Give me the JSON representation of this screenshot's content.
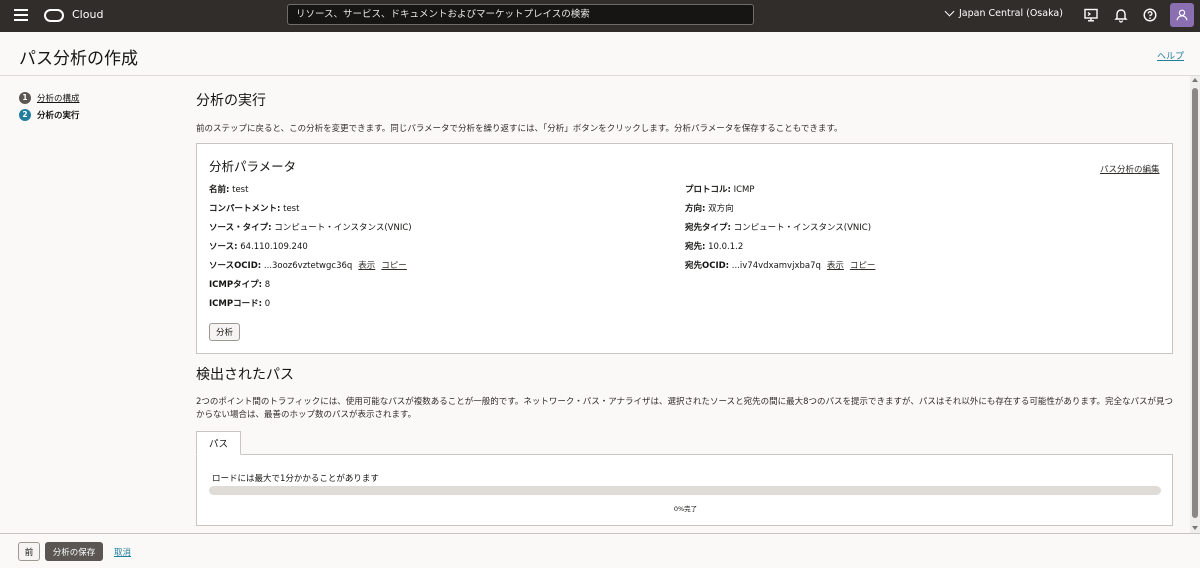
{
  "topbar": {
    "brand": "Cloud",
    "search_placeholder": "リソース、サービス、ドキュメントおよびマーケットプレイスの検索",
    "region": "Japan Central (Osaka)"
  },
  "page": {
    "title": "パス分析の作成",
    "help": "ヘルプ"
  },
  "steps": [
    {
      "num": "1",
      "label": "分析の構成"
    },
    {
      "num": "2",
      "label": "分析の実行"
    }
  ],
  "run": {
    "title": "分析の実行",
    "description": "前のステップに戻ると、この分析を変更できます。同じパラメータで分析を繰り返すには、「分析」ボタンをクリックします。分析パラメータを保存することもできます。"
  },
  "params": {
    "title": "分析パラメータ",
    "edit_link": "パス分析の編集",
    "left": [
      {
        "label": "名前:",
        "value": "test"
      },
      {
        "label": "コンパートメント:",
        "value": "test"
      },
      {
        "label": "ソース・タイプ:",
        "value": "コンピュート・インスタンス(VNIC)"
      },
      {
        "label": "ソース:",
        "value": "64.110.109.240"
      },
      {
        "label": "ソースOCID:",
        "value": "...3ooz6vztetwgc36q"
      },
      {
        "label": "ICMPタイプ:",
        "value": "8"
      },
      {
        "label": "ICMPコード:",
        "value": "0"
      }
    ],
    "right": [
      {
        "label": "プロトコル:",
        "value": "ICMP"
      },
      {
        "label": "方向:",
        "value": "双方向"
      },
      {
        "label": "宛先タイプ:",
        "value": "コンピュート・インスタンス(VNIC)"
      },
      {
        "label": "宛先:",
        "value": "10.0.1.2"
      },
      {
        "label": "宛先OCID:",
        "value": "...iv74vdxamvjxba7q"
      }
    ],
    "show_link": "表示",
    "copy_link": "コピー",
    "analyze_button": "分析"
  },
  "paths": {
    "title": "検出されたパス",
    "description": "2つのポイント間のトラフィックには、使用可能なパスが複数あることが一般的です。ネットワーク・パス・アナライザは、選択されたソースと宛先の間に最大8つのパスを提示できますが、パスはそれ以外にも存在する可能性があります。完全なパスが見つからない場合は、最善のホップ数のパスが表示されます。",
    "tab_label": "パス",
    "loading_text": "ロードには最大で1分かかることがあります",
    "progress_fraction": 0,
    "progress_label": "0%完了"
  },
  "footer": {
    "prev_button": "前",
    "save_button": "分析の保存",
    "cancel_link": "取消"
  },
  "colors": {
    "header_bg": "#312d2a",
    "link": "#227e9e",
    "avatar": "#8a6fb2"
  },
  "icons": [
    "hamburger-icon",
    "oracle-logo-icon",
    "chevron-down-icon",
    "cloud-shell-icon",
    "bell-icon",
    "help-icon",
    "user-icon"
  ]
}
